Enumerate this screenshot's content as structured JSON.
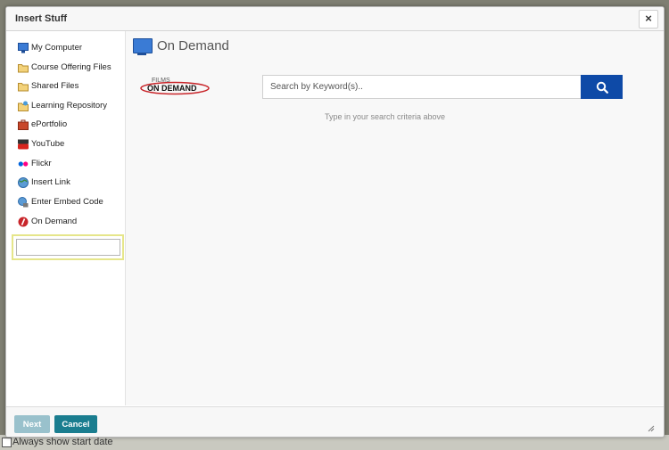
{
  "background": {
    "checkbox_label": "Always show start date"
  },
  "dialog": {
    "title": "Insert Stuff",
    "close_label": "×"
  },
  "sidebar": {
    "items": [
      {
        "label": "My Computer",
        "icon": "computer-icon"
      },
      {
        "label": "Course Offering Files",
        "icon": "folder-icon"
      },
      {
        "label": "Shared Files",
        "icon": "folder-icon"
      },
      {
        "label": "Learning Repository",
        "icon": "repository-icon"
      },
      {
        "label": "ePortfolio",
        "icon": "briefcase-icon"
      },
      {
        "label": "YouTube",
        "icon": "youtube-icon"
      },
      {
        "label": "Flickr",
        "icon": "flickr-icon"
      },
      {
        "label": "Insert Link",
        "icon": "globe-icon"
      },
      {
        "label": "Enter Embed Code",
        "icon": "embed-icon"
      },
      {
        "label": "On Demand",
        "icon": "films-on-demand-icon",
        "selected": true
      }
    ]
  },
  "main": {
    "title": "On Demand",
    "logo": {
      "small": "FILMS",
      "large": "ON DEMAND"
    },
    "search_placeholder": "Search by Keyword(s)..",
    "hint": "Type in your search criteria above"
  },
  "footer": {
    "next_label": "Next",
    "cancel_label": "Cancel"
  },
  "colors": {
    "search_button": "#0e4aa7",
    "cancel_button": "#1a7d8f",
    "next_button_disabled": "#99c1cc",
    "highlight": "#e6e68a"
  }
}
